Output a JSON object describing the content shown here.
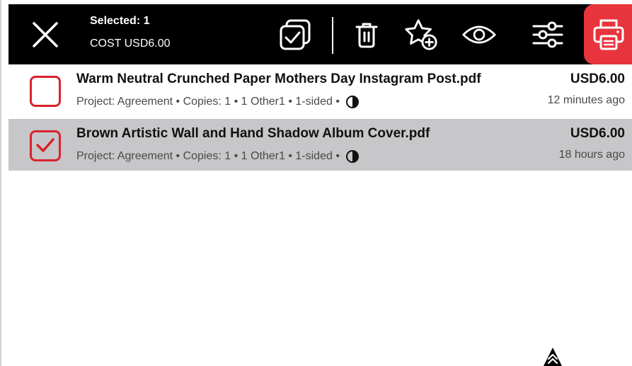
{
  "header": {
    "selected_label": "Selected: 1",
    "cost_label": "COST USD6.00"
  },
  "toolbar": {
    "icons": [
      "select-all-icon",
      "trash-icon",
      "favorite-add-icon",
      "eye-icon",
      "settings-sliders-icon",
      "printer-icon"
    ]
  },
  "colors": {
    "accent": "#e8353d",
    "checkbox": "#d8232e",
    "selected_row": "#c7c6c8"
  },
  "jobs": [
    {
      "title": "Warm Neutral Crunched Paper Mothers Day Instagram Post.pdf",
      "price": "USD6.00",
      "meta": "Project: Agreement • Copies: 1 • 1 Other1 • 1-sided •",
      "time": "12 minutes ago",
      "selected": false
    },
    {
      "title": "Brown Artistic Wall and Hand Shadow Album Cover.pdf",
      "price": "USD6.00",
      "meta": "Project: Agreement • Copies: 1 • 1 Other1 • 1-sided •",
      "time": "18 hours ago",
      "selected": true
    }
  ]
}
